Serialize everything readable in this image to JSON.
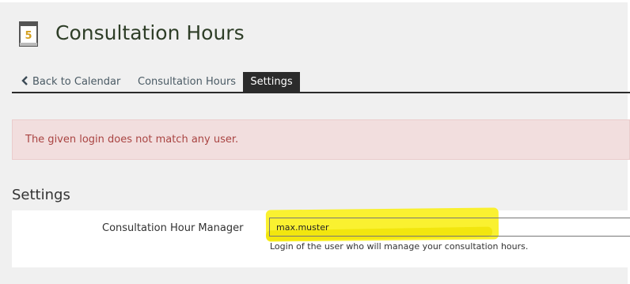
{
  "header": {
    "title": "Consultation Hours",
    "icon": "calendar-day-icon",
    "icon_day": "5",
    "icon_colors": {
      "page": "#ffffff",
      "border": "#555555",
      "digit": "#d4a020",
      "stripe": "#555555"
    }
  },
  "tabs": [
    {
      "label": "Back to Calendar",
      "icon": "chevron-left-icon",
      "active": false
    },
    {
      "label": "Consultation Hours",
      "active": false
    },
    {
      "label": "Settings",
      "active": true
    }
  ],
  "alert": {
    "message": "The given login does not match any user.",
    "colors": {
      "background": "#f2dede",
      "text": "#a94442"
    }
  },
  "settings": {
    "section_title": "Settings",
    "field": {
      "label": "Consultation Hour Manager",
      "value": "max.muster",
      "help": "Login of the user who will manage your consultation hours."
    },
    "highlight_color": "#f9ef1a"
  },
  "colors": {
    "active_tab_bg": "#2b2b2b",
    "page_background": "#f0f0f0",
    "title_text": "#2e3e27"
  }
}
